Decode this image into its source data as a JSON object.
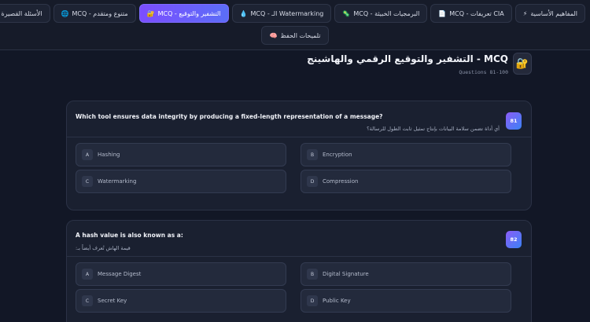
{
  "tabs": [
    {
      "label": "المفاهيم الأساسية",
      "icon": "⚡",
      "active": false
    },
    {
      "label": "MCQ - تعريفات CIA",
      "icon": "📄",
      "active": false
    },
    {
      "label": "MCQ - البرمجيات الخبيثة",
      "icon": "🦠",
      "active": false
    },
    {
      "label": "MCQ - الـ Watermarking",
      "icon": "💧",
      "active": false
    },
    {
      "label": "MCQ - التشفير والتوقيع",
      "icon": "🔐",
      "active": true
    },
    {
      "label": "MCQ - متنوع ومتقدم",
      "icon": "🌐",
      "active": false
    },
    {
      "label": "الأسئلة القصيرة",
      "icon": "📖",
      "active": false
    }
  ],
  "tab_row2": {
    "label": "تلميحات الحفظ",
    "icon": "🧠"
  },
  "header": {
    "icon": "🔐",
    "title": "MCQ - التشفير والتوقيع الرقمي والهاشينج",
    "subtitle": "Questions 81-100"
  },
  "questions": [
    {
      "number": "81",
      "text": "Which tool ensures data integrity by producing a fixed-length representation of a message?",
      "arabic": "أي أداة تضمن سلامة البيانات بإنتاج تمثيل ثابت الطول للرسالة؟",
      "options": [
        {
          "letter": "A",
          "text": "Hashing"
        },
        {
          "letter": "B",
          "text": "Encryption"
        },
        {
          "letter": "C",
          "text": "Watermarking"
        },
        {
          "letter": "D",
          "text": "Compression"
        }
      ]
    },
    {
      "number": "82",
      "text": "A hash value is also known as a:",
      "arabic": "قيمة الهاش تُعرف أيضاً بـ:",
      "options": [
        {
          "letter": "A",
          "text": "Message Digest"
        },
        {
          "letter": "B",
          "text": "Digital Signature"
        },
        {
          "letter": "C",
          "text": "Secret Key"
        },
        {
          "letter": "D",
          "text": "Public Key"
        }
      ]
    }
  ]
}
